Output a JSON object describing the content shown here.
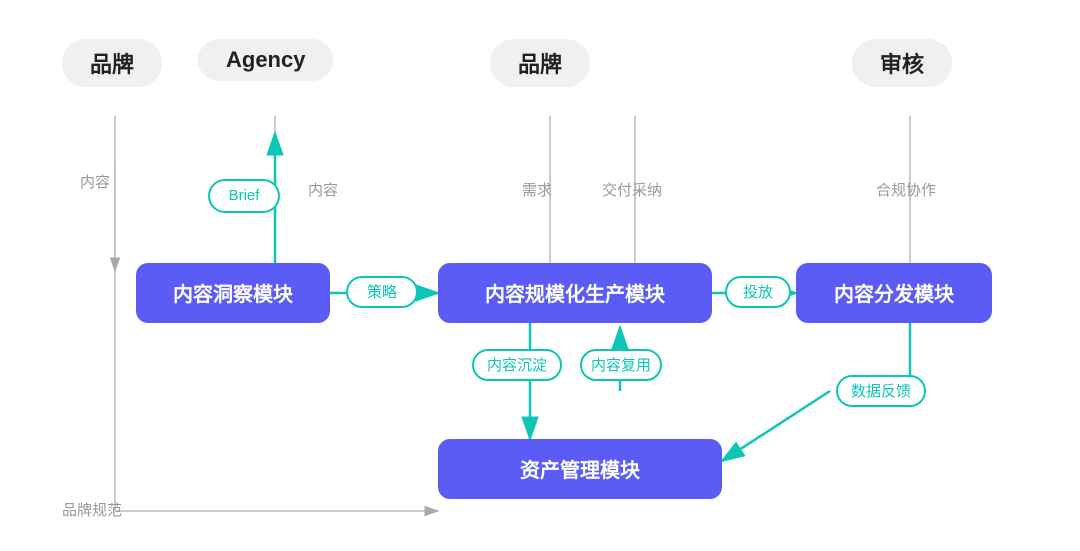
{
  "headers": {
    "col1": "品牌",
    "col2": "Agency",
    "col3": "品牌",
    "col4": "审核"
  },
  "modules": {
    "insight": "内容洞察模块",
    "production": "内容规模化生产模块",
    "distribution": "内容分发模块",
    "asset": "资产管理模块"
  },
  "pills": {
    "brief": "Brief",
    "strategy": "策略",
    "placement": "投放",
    "sedimentation": "内容沉淀",
    "reuse": "内容复用",
    "feedback": "数据反馈"
  },
  "labels": {
    "content1": "内容",
    "content2": "内容",
    "demand": "需求",
    "delivery": "交付采纳",
    "compliance": "合规协作",
    "brand_spec": "品牌规范"
  }
}
